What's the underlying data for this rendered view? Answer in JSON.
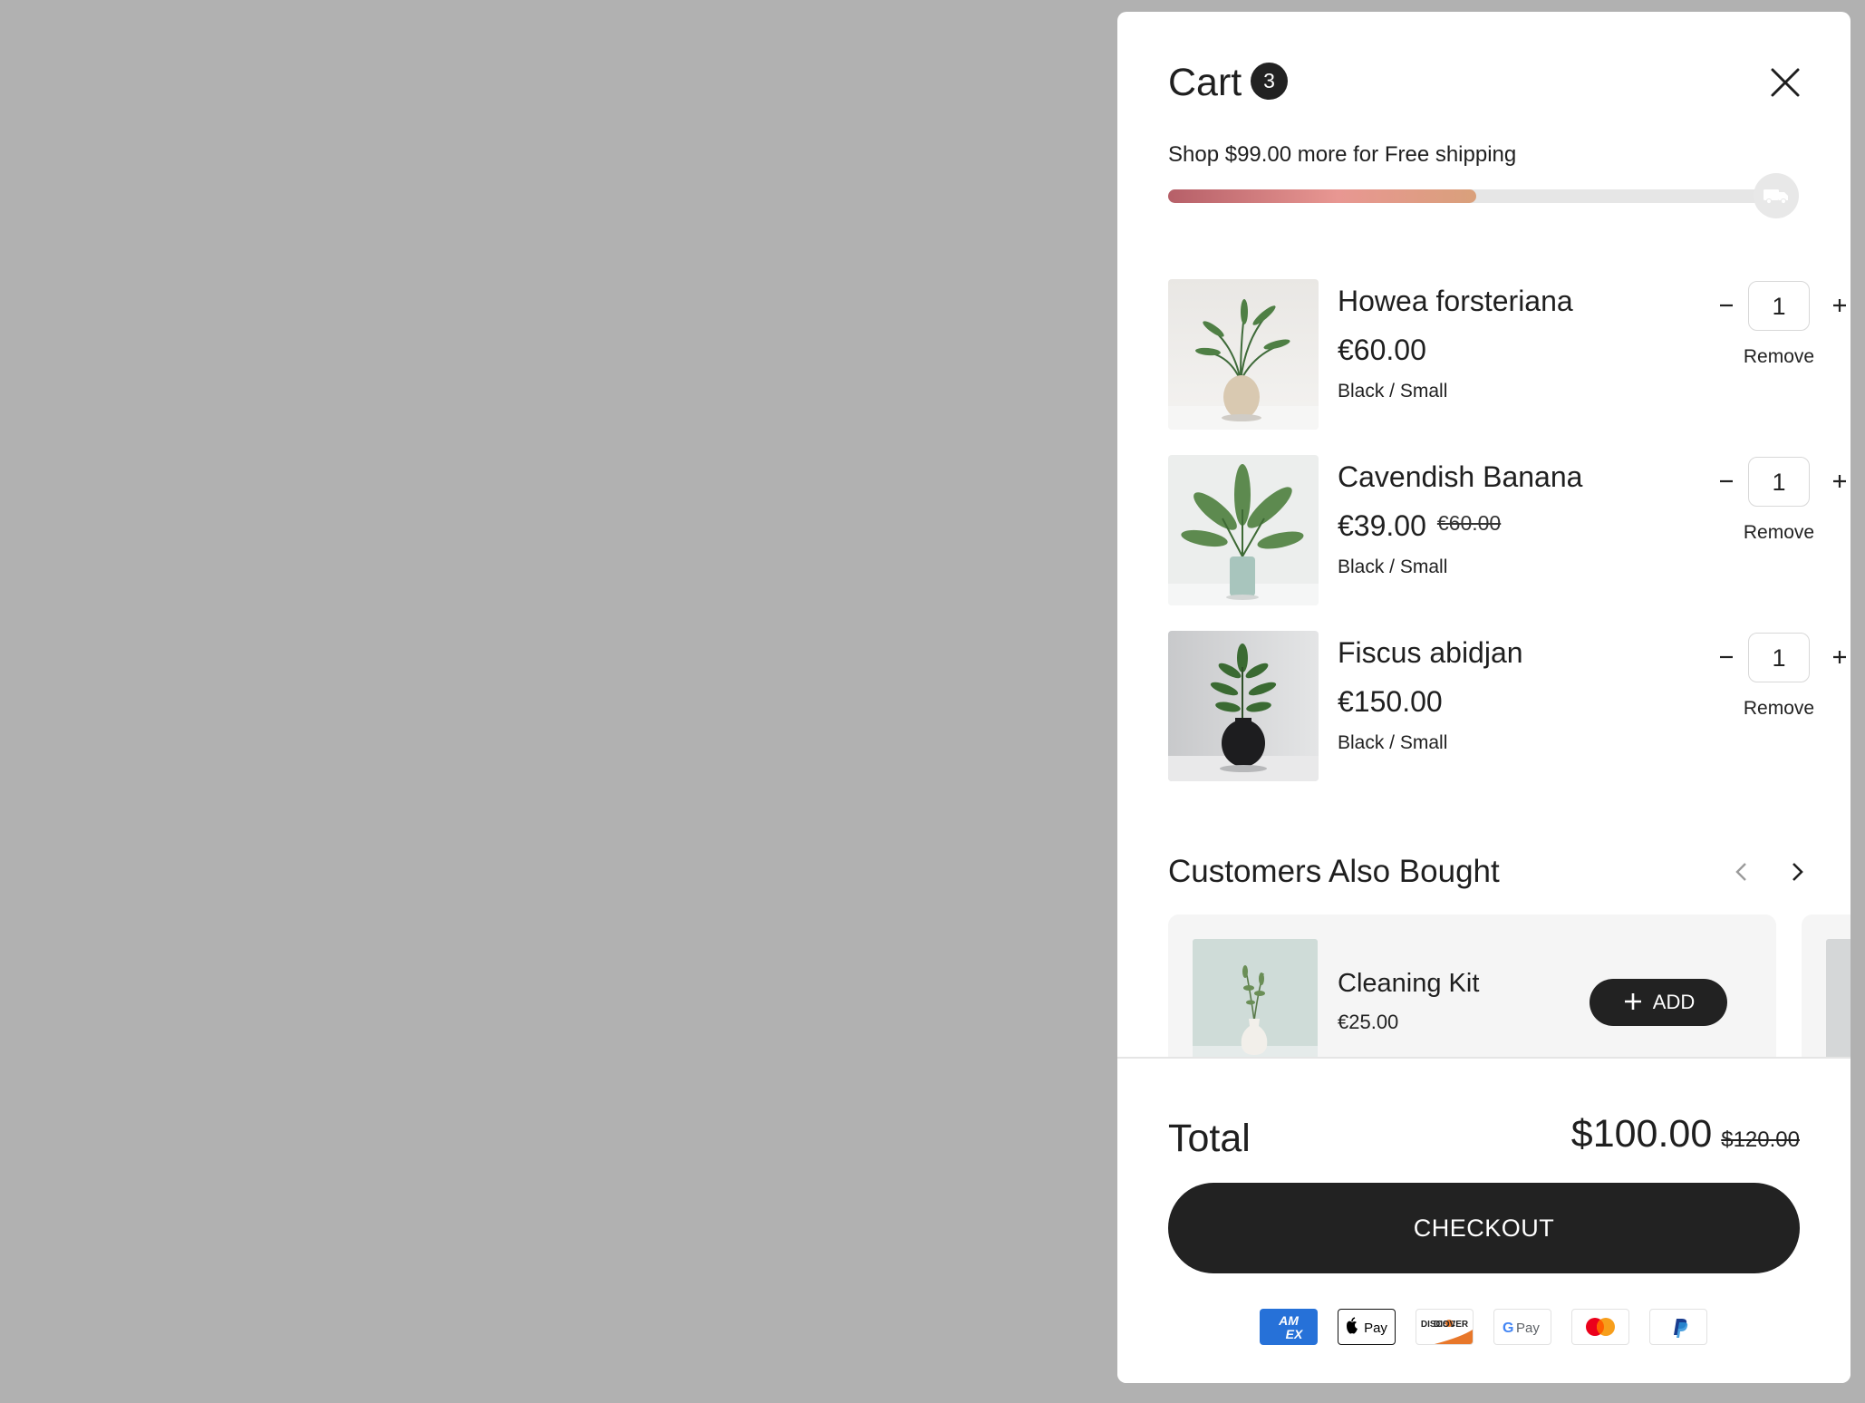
{
  "cart": {
    "title": "Cart",
    "count": "3",
    "shipping_message": "Shop $99.00 more for Free shipping",
    "shipping_progress": 0.5
  },
  "items": [
    {
      "name": "Howea forsteriana",
      "price": "€60.00",
      "compare_price": "",
      "variant": "Black / Small",
      "qty": "1",
      "remove_label": "Remove"
    },
    {
      "name": "Cavendish Banana",
      "price": "€39.00",
      "compare_price": "€60.00",
      "variant": "Black / Small",
      "qty": "1",
      "remove_label": "Remove"
    },
    {
      "name": "Fiscus abidjan",
      "price": "€150.00",
      "compare_price": "",
      "variant": "Black / Small",
      "qty": "1",
      "remove_label": "Remove"
    }
  ],
  "upsell": {
    "title": "Customers Also Bought",
    "products": [
      {
        "name": "Cleaning Kit",
        "price": "€25.00",
        "add_label": "ADD"
      }
    ]
  },
  "footer": {
    "total_label": "Total",
    "total_value": "$100.00",
    "total_compare": "$120.00",
    "checkout_label": "CHECKOUT",
    "payment_methods": [
      "amex-icon",
      "apple-pay-icon",
      "discover-icon",
      "google-pay-icon",
      "mastercard-icon",
      "paypal-icon"
    ]
  },
  "colors": {
    "backdrop": "#b1b1b1",
    "button_dark": "#222222",
    "progress_start": "#b65f68",
    "progress_end": "#d9a07b"
  }
}
